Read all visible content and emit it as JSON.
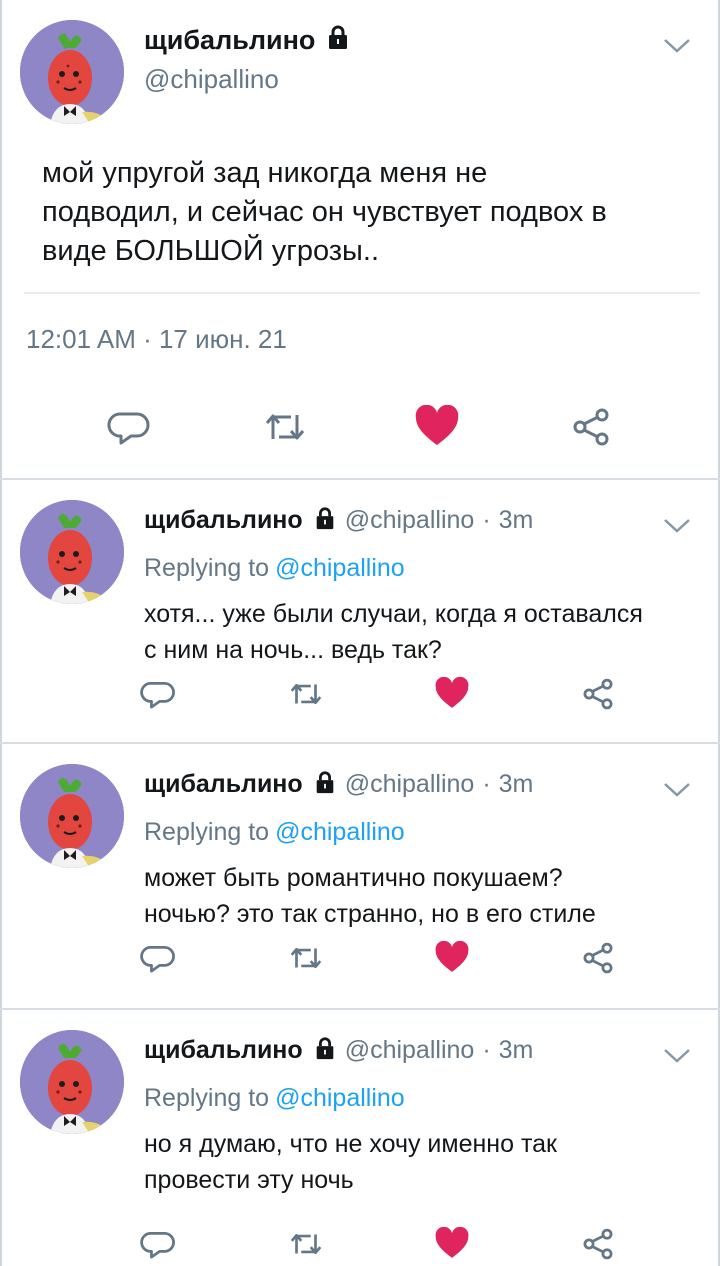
{
  "main_tweet": {
    "display_name": "щибальлино",
    "handle": "@chipallino",
    "protected_icon": "lock-icon",
    "text": "мой упругой зад никогда меня не\nподводил, и сейчас он чувствует подвох в\nвиде БОЛЬШОЙ угрозы..",
    "timestamp": "12:01 AM · 17 июн. 21",
    "actions": {
      "reply": "reply-icon",
      "retweet": "retweet-icon",
      "like": "heart-icon",
      "share": "share-icon"
    },
    "liked": true
  },
  "replies": [
    {
      "display_name": "щибальлино",
      "handle": "@chipallino",
      "separator": "·",
      "time": "3m",
      "replying_prefix": "Replying to",
      "replying_to": "@chipallino",
      "text": "хотя... уже были случаи, когда я оставался\nс ним на ночь... ведь так?",
      "liked": true
    },
    {
      "display_name": "щибальлино",
      "handle": "@chipallino",
      "separator": "·",
      "time": "3m",
      "replying_prefix": "Replying to",
      "replying_to": "@chipallino",
      "text": "может быть романтично покушаем?\nночью? это так странно, но в его стиле",
      "liked": true
    },
    {
      "display_name": "щибальлино",
      "handle": "@chipallino",
      "separator": "·",
      "time": "3m",
      "replying_prefix": "Replying to",
      "replying_to": "@chipallino",
      "text": "но я думаю, что не хочу именно так\nпровести эту ночь",
      "liked": true
    }
  ],
  "colors": {
    "text": "#14171a",
    "secondary": "#657786",
    "link": "#1da1f2",
    "like": "#e0245e",
    "icon": "#657786",
    "divider": "#e6ecf0",
    "avatar_bg": "#8f86c8"
  }
}
